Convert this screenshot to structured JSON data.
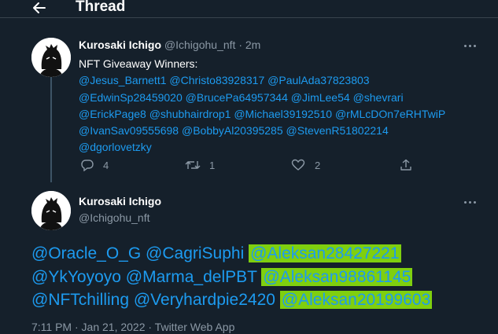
{
  "header": {
    "title": "Thread"
  },
  "reply_tweet": {
    "author_name": "Kurosaki Ichigo",
    "author_handle": "@Ichigohu_nft",
    "separator": "·",
    "time": "2m",
    "text_intro": "NFT Giveaway Winners:",
    "mentions": [
      [
        "@Jesus_Barnett1",
        "@Christo83928317",
        "@PaulAda37823803"
      ],
      [
        "@EdwinSp28459020",
        "@BrucePa64957344",
        "@JimLee54",
        "@shevrari"
      ],
      [
        "@ErickPage8",
        "@shubhairdrop1",
        "@Michael39192510",
        "@rMLcDOn7eRHTwiP"
      ],
      [
        "@IvanSav09555698",
        "@BobbyAl20395285",
        "@StevenR51802214"
      ],
      [
        "@dgorlovetzky"
      ]
    ],
    "actions": {
      "reply_count": "4",
      "retweet_count": "1",
      "like_count": "2"
    }
  },
  "main_tweet": {
    "author_name": "Kurosaki Ichigo",
    "author_handle": "@Ichigohu_nft",
    "lines": [
      {
        "plain": "@Oracle_O_G @CagriSuphi ",
        "highlighted": "@Aleksan28427221"
      },
      {
        "plain": "@YkYoyoyo @Marma_delPBT ",
        "highlighted": "@Aleksan98861145"
      },
      {
        "plain": "@NFTchilling @Veryhardpie2420 ",
        "highlighted": "@Aleksan20199603"
      }
    ],
    "footer": "7:11 PM · Jan 21, 2022 · Twitter Web App"
  },
  "colors": {
    "background": "#15202b",
    "link": "#1d9bf0",
    "muted": "#8b98a5",
    "highlight": "#7fcf0f",
    "divider": "#38444d"
  },
  "icons": [
    "back-arrow-icon",
    "more-icon",
    "reply-icon",
    "retweet-icon",
    "like-icon",
    "share-icon"
  ]
}
